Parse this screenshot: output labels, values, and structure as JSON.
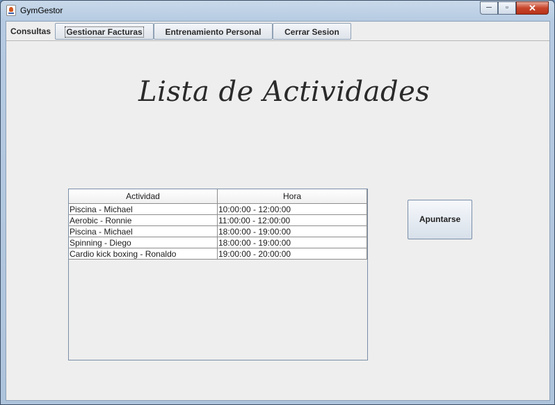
{
  "window": {
    "title": "GymGestor"
  },
  "window_controls": {
    "minimize": "─",
    "maximize": "▫",
    "close": "✕"
  },
  "menubar": {
    "items": [
      {
        "label": "Consultas"
      },
      {
        "label": "Gestionar Facturas"
      },
      {
        "label": "Entrenamiento Personal"
      },
      {
        "label": "Cerrar Sesion"
      }
    ]
  },
  "main": {
    "heading": "Lista de Actividades",
    "table": {
      "columns": [
        "Actividad",
        "Hora"
      ],
      "rows": [
        [
          "Piscina - Michael",
          "10:00:00 - 12:00:00"
        ],
        [
          "Aerobic - Ronnie",
          "11:00:00 - 12:00:00"
        ],
        [
          "Piscina - Michael",
          "18:00:00 - 19:00:00"
        ],
        [
          "Spinning - Diego",
          "18:00:00 - 19:00:00"
        ],
        [
          "Cardio kick boxing - Ronaldo",
          "19:00:00 - 20:00:00"
        ]
      ]
    },
    "apuntarse_label": "Apuntarse"
  }
}
